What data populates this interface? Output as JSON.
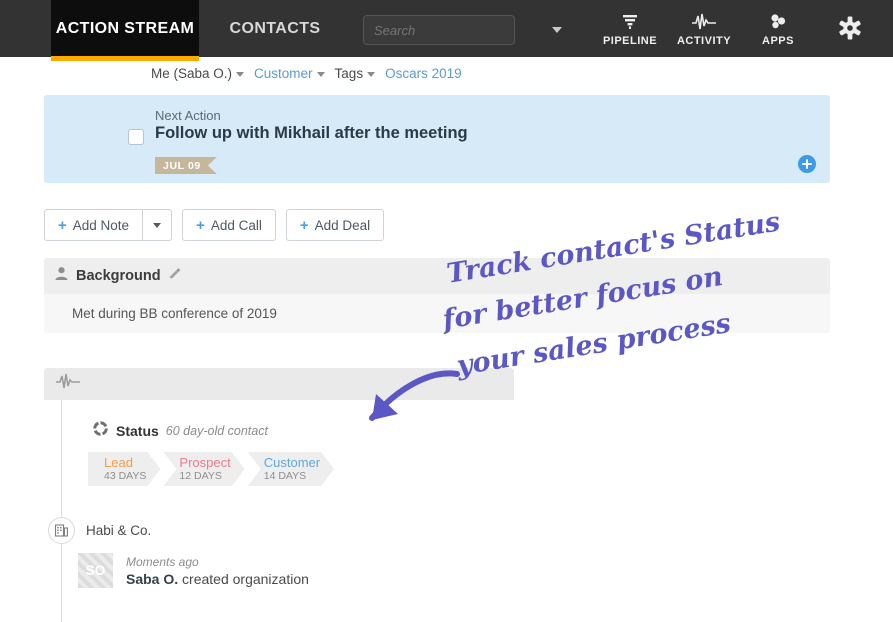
{
  "topnav": {
    "tabs": [
      {
        "label": "ACTION STREAM",
        "active": true
      },
      {
        "label": "CONTACTS",
        "active": false
      }
    ],
    "search": {
      "placeholder": "Search",
      "value": ""
    },
    "icons": [
      {
        "label": "PIPELINE",
        "icon": "funnel-icon"
      },
      {
        "label": "ACTIVITY",
        "icon": "pulse-icon"
      },
      {
        "label": "APPS",
        "icon": "apps-icon"
      },
      {
        "label": "",
        "icon": "gear-icon"
      }
    ],
    "accent_color": "#ffab00",
    "bar_color": "#333333"
  },
  "breadcrumb": {
    "owner": "Me (Saba O.)",
    "status": "Customer",
    "tags_label": "Tags",
    "tag_value": "Oscars 2019"
  },
  "next_action": {
    "label": "Next Action",
    "title": "Follow up with Mikhail after the meeting",
    "date_tag": "JUL 09",
    "panel_color": "#d6eaf8",
    "tag_color": "#c6b79b",
    "add_button": "add-icon"
  },
  "action_buttons": [
    {
      "label": "Add Note",
      "icon": "plus-icon",
      "has_dropdown": true
    },
    {
      "label": "Add Call",
      "icon": "plus-icon",
      "has_dropdown": false
    },
    {
      "label": "Add Deal",
      "icon": "plus-icon",
      "has_dropdown": false
    }
  ],
  "background_card": {
    "title": "Background",
    "edit_icon": "pencil-icon",
    "person_icon": "person-icon",
    "body": "Met during BB conference of 2019"
  },
  "timeline": {
    "header_icon": "pulse-icon",
    "status": {
      "icon": "status-cycle-icon",
      "title": "Status",
      "subtitle": "60 day-old contact",
      "steps": [
        {
          "name": "Lead",
          "days": "43 DAYS",
          "color": "#f39c4b"
        },
        {
          "name": "Prospect",
          "days": "12 DAYS",
          "color": "#ef7b8d"
        },
        {
          "name": "Customer",
          "days": "14 DAYS",
          "color": "#5fa8e0"
        }
      ]
    },
    "organization": {
      "icon": "building-icon",
      "name": "Habi & Co."
    },
    "event": {
      "avatar_initials": "SO",
      "when": "Moments ago",
      "actor": "Saba O.",
      "action": " created organization"
    }
  },
  "annotation": {
    "line1": "Track contact's Status",
    "line2": "for better focus on",
    "line3": "your sales process",
    "color": "#5b57c4",
    "arrow": "curved-arrow-icon"
  }
}
